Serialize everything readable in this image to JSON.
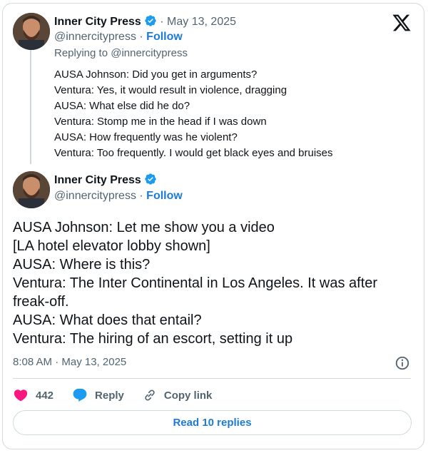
{
  "quoted_tweet": {
    "author_name": "Inner City Press",
    "date": "· May 13, 2025",
    "handle": "@innercitypress",
    "separator": " · ",
    "follow_label": "Follow",
    "replying_to": "Replying to @innercitypress",
    "lines": [
      "AUSA Johnson: Did you get in arguments?",
      "Ventura: Yes, it would result in violence, dragging",
      "AUSA: What else did he do?",
      "Ventura: Stomp me in the head if I was down",
      "AUSA: How frequently was he violent?",
      "Ventura: Too frequently. I would get black eyes and bruises"
    ]
  },
  "main_tweet": {
    "author_name": "Inner City Press",
    "handle": "@innercitypress",
    "separator": " · ",
    "follow_label": "Follow",
    "lines": [
      "AUSA Johnson: Let me show you a video",
      "[LA hotel elevator lobby shown]",
      "AUSA: Where is this?",
      "Ventura: The Inter Continental in Los Angeles. It was after freak-off.",
      "AUSA: What does that entail?",
      "Ventura: The hiring of an escort, setting it up"
    ],
    "timestamp": "8:08 AM · May 13, 2025"
  },
  "actions": {
    "like_count": "442",
    "reply_label": "Reply",
    "copy_link_label": "Copy link"
  },
  "read_replies_label": "Read 10 replies",
  "colors": {
    "verified": "#1d9bf0",
    "like": "#f91880",
    "reply": "#1d9bf0",
    "link": "#1d7bd8"
  },
  "icons": [
    "verified-badge-icon",
    "x-logo-icon",
    "info-icon",
    "heart-icon",
    "reply-bubble-icon",
    "link-icon"
  ]
}
